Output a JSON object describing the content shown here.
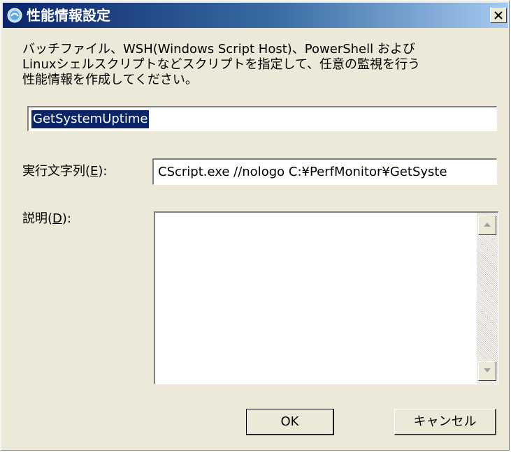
{
  "window": {
    "title": "性能情報設定",
    "close_label": "×"
  },
  "description": "バッチファイル、WSH(Windows Script Host)、PowerShell および\nLinuxシェルスクリプトなどスクリプトを指定して、任意の監視を行う\n性能情報を作成してください。",
  "name_field": {
    "value": "GetSystemUptime"
  },
  "exec": {
    "label_prefix": "実行文字列(",
    "accelerator": "E",
    "label_suffix": "):",
    "value": "CScript.exe //nologo C:¥PerfMonitor¥GetSyste"
  },
  "desc": {
    "label_prefix": "説明(",
    "accelerator": "D",
    "label_suffix": "):",
    "value": ""
  },
  "buttons": {
    "ok": "OK",
    "cancel": "キャンセル"
  },
  "icons": {
    "app": "app-icon",
    "close": "close-icon",
    "scroll_up": "scroll-up-icon",
    "scroll_down": "scroll-down-icon"
  },
  "colors": {
    "title_gradient_start": "#0a246a",
    "title_gradient_end": "#a6caf0",
    "dialog_bg": "#ece9d8",
    "selection_bg": "#0a246a"
  }
}
